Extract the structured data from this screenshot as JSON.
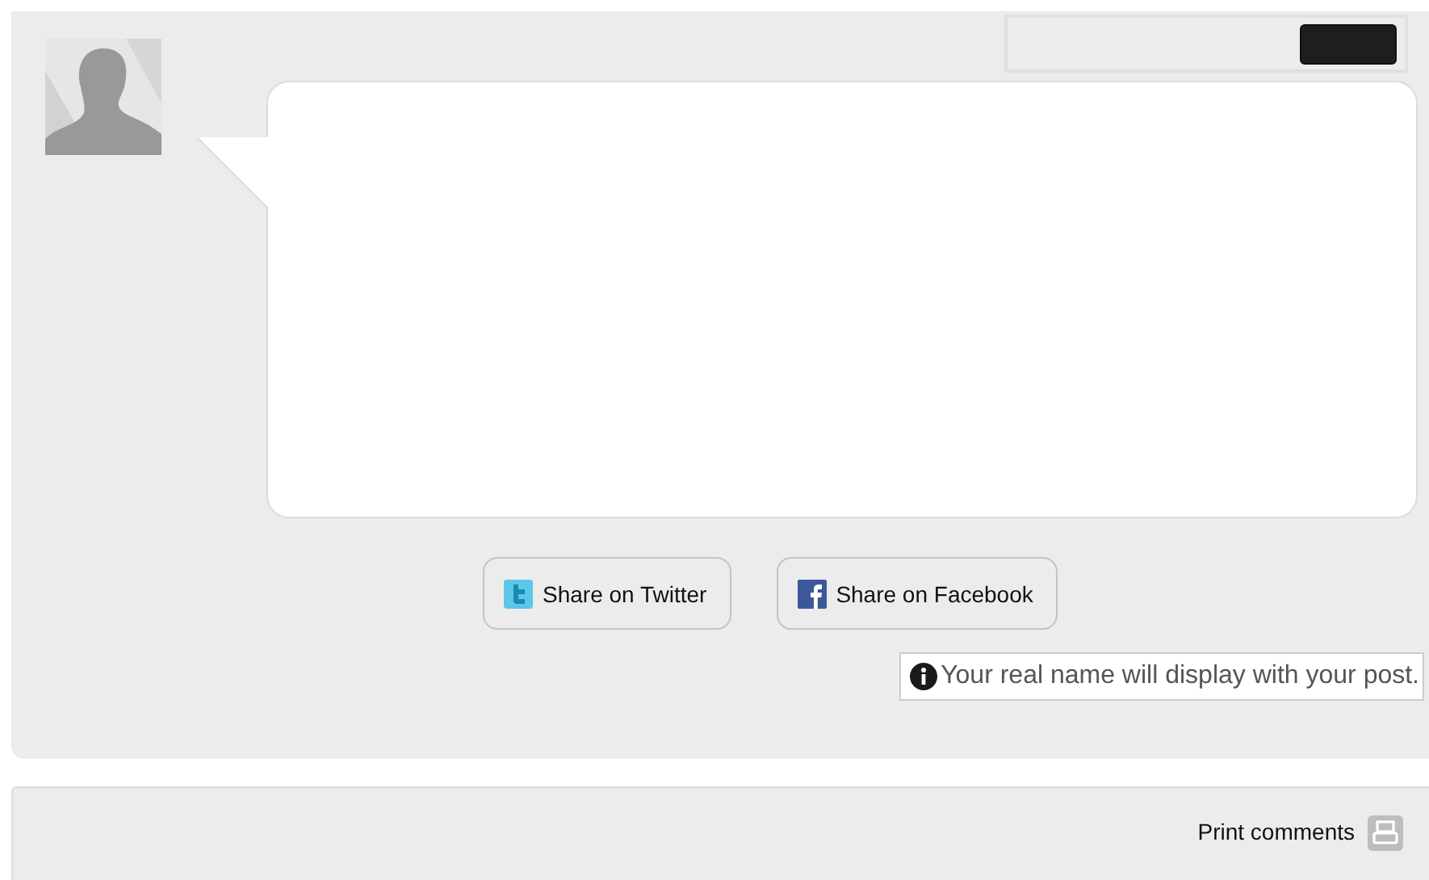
{
  "comment_form": {
    "share_buttons": [
      {
        "kind": "twitter",
        "label": "Share on Twitter"
      },
      {
        "kind": "facebook",
        "label": "Share on Facebook"
      }
    ],
    "notice": "Your real name will display with your post."
  },
  "footer": {
    "print_link": "Print comments"
  }
}
